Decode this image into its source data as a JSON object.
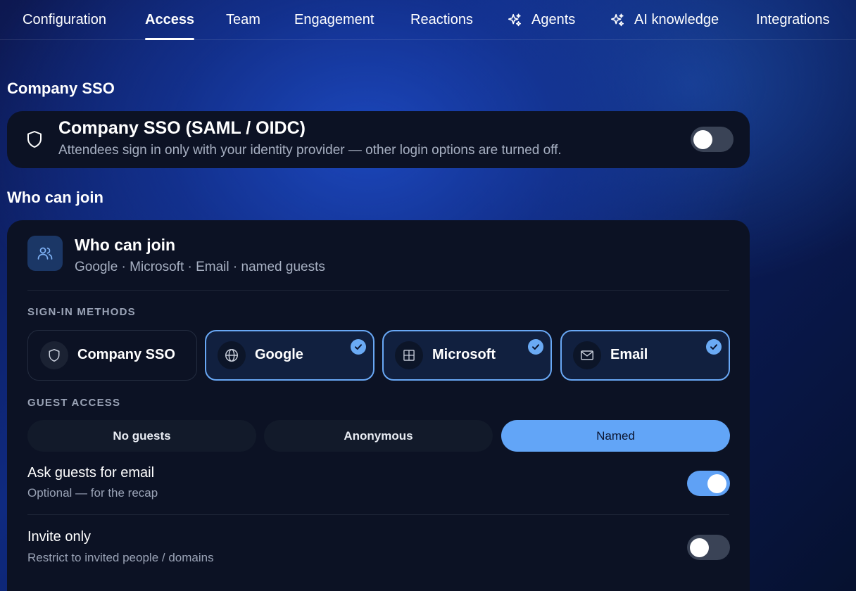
{
  "nav": {
    "items": [
      {
        "label": "Configuration",
        "icon": null,
        "active": false
      },
      {
        "label": "Access",
        "icon": null,
        "active": true
      },
      {
        "label": "Team",
        "icon": null,
        "active": false
      },
      {
        "label": "Engagement",
        "icon": null,
        "active": false
      },
      {
        "label": "Reactions",
        "icon": null,
        "active": false
      },
      {
        "label": "Agents",
        "icon": "sparkles-icon",
        "active": false
      },
      {
        "label": "AI knowledge",
        "icon": "sparkles-icon",
        "active": false
      },
      {
        "label": "Integrations",
        "icon": null,
        "active": false
      }
    ]
  },
  "sso_section": {
    "heading": "Company SSO",
    "card": {
      "icon": "shield-icon",
      "title": "Company SSO (SAML / OIDC)",
      "subtitle": "Attendees sign in only with your identity provider — other login options are turned off.",
      "enabled": false
    }
  },
  "join_section": {
    "heading": "Who can join",
    "card": {
      "icon": "users-icon",
      "title": "Who can join",
      "summary": "Google · Microsoft · Email · named guests",
      "sign_in_label": "SIGN-IN METHODS",
      "methods": [
        {
          "label": "Company SSO",
          "icon": "shield-icon",
          "selected": false
        },
        {
          "label": "Google",
          "icon": "globe-icon",
          "selected": true
        },
        {
          "label": "Microsoft",
          "icon": "windows-icon",
          "selected": true
        },
        {
          "label": "Email",
          "icon": "mail-icon",
          "selected": true
        }
      ],
      "guest_label": "GUEST ACCESS",
      "guest_options": [
        {
          "label": "No guests",
          "active": false
        },
        {
          "label": "Anonymous",
          "active": false
        },
        {
          "label": "Named",
          "active": true
        }
      ],
      "settings": [
        {
          "title": "Ask guests for email",
          "subtitle": "Optional — for the recap",
          "enabled": true
        },
        {
          "title": "Invite only",
          "subtitle": "Restrict to invited people / domains",
          "enabled": false
        }
      ]
    }
  },
  "colors": {
    "accent": "#62a5f7",
    "card_bg": "#0c1224",
    "toggle_off": "#3a4356",
    "muted_text": "#a7b0c2"
  }
}
